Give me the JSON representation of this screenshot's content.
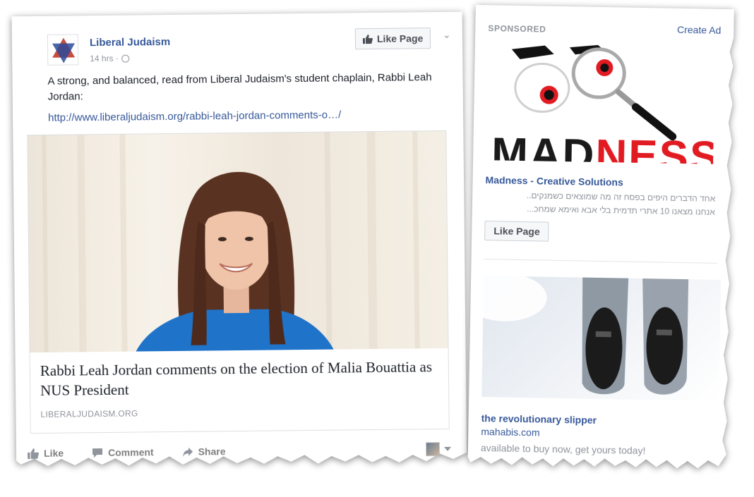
{
  "post": {
    "page_name": "Liberal Judaism",
    "time": "14 hrs · ",
    "like_page_label": "Like Page",
    "text": "A strong, and balanced, read from Liberal Judaism's student chaplain, Rabbi Leah Jordan:",
    "link": "http://www.liberaljudaism.org/rabbi-leah-jordan-comments-o…/",
    "preview": {
      "title": "Rabbi Leah Jordan comments on the election of Malia Bouattia as NUS President",
      "domain": "LIBERALJUDAISM.ORG"
    },
    "actions": {
      "like": "Like",
      "comment": "Comment",
      "share": "Share"
    }
  },
  "sidebar": {
    "sponsored_label": "SPONSORED",
    "create_ad": "Create Ad",
    "ad1": {
      "logo_text_black_1": "MAD",
      "logo_text_red": "NE",
      "logo_text_black_2": "SS",
      "title": "Madness - Creative Solutions",
      "line1": "אחד הדברים היפים בפסח זה מה שמוצאים כשמנקים..",
      "line2": "אנחנו מצאנו 10 אתרי תדמית בלי אבא ואימא שמחכ...",
      "like_label": "Like Page"
    },
    "ad2": {
      "title": "the revolutionary slipper",
      "domain": "mahabis.com",
      "description": "available to buy now, get yours today!"
    }
  },
  "colors": {
    "link_blue": "#365899",
    "meta_gray": "#90949c",
    "brand_red": "#e21b23"
  }
}
